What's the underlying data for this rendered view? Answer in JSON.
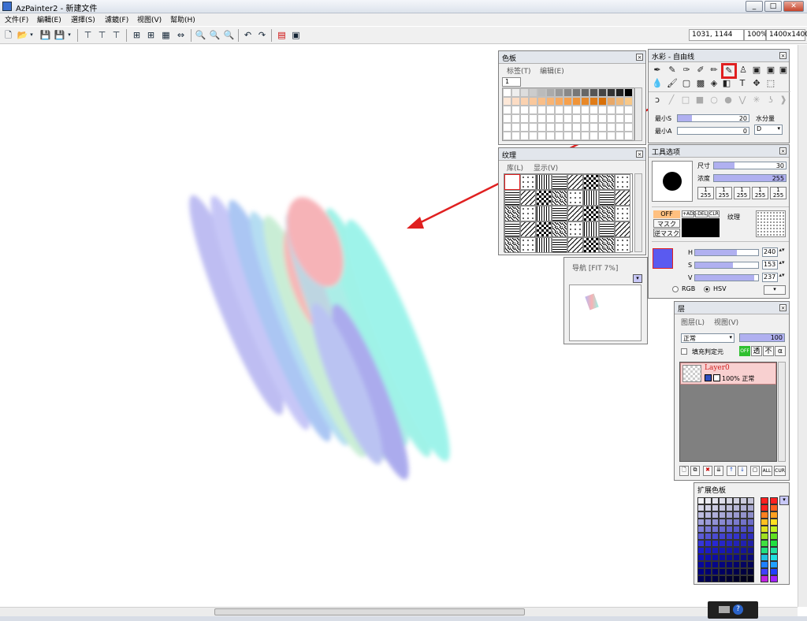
{
  "window": {
    "title": "AzPainter2 - 新建文件",
    "min": "_",
    "max": "□",
    "close": "✕"
  },
  "menu": [
    "文件(F)",
    "編輯(E)",
    "選擇(S)",
    "濾鏡(F)",
    "视图(V)",
    "幫助(H)"
  ],
  "status": {
    "coords": "1031, 1144",
    "zoom": "100%",
    "size": "1400x1400"
  },
  "palette_panel": {
    "title": "色板",
    "menu_tab": "标签(T)",
    "menu_edit": "编辑(E)",
    "tab": "1"
  },
  "texture_panel": {
    "title": "纹理",
    "menu_lib": "库(L)",
    "menu_show": "显示(V)"
  },
  "nav_panel": {
    "title": "导航 [FIT 7%]"
  },
  "brush_panel": {
    "title": "水彩 - 自由线",
    "min_s_label": "最小S",
    "min_s_val": "20",
    "min_a_label": "最小A",
    "min_a_val": "0",
    "water_label": "水分量",
    "water_val": "D"
  },
  "tool_options": {
    "title": "工具选项",
    "size_label": "尺寸",
    "size_val": "30",
    "density_label": "浓度",
    "density_val": "255",
    "presets": [
      "1 255",
      "1 255",
      "1 255",
      "1 255",
      "1 255"
    ],
    "off_label": "OFF",
    "mask_label": "マスク",
    "rev_mask_label": "逆マスク",
    "add_label": "+ADD",
    "del_label": "-DEL",
    "clr_label": "CLR",
    "texture_label": "纹理",
    "h_label": "H",
    "h_val": "240",
    "s_label": "S",
    "s_val": "153",
    "v_label": "V",
    "v_val": "237",
    "rgb_label": "RGB",
    "hsv_label": "HSV",
    "color": "#5a5af0"
  },
  "layer_panel": {
    "title": "层",
    "menu_layer": "图层(L)",
    "menu_view": "视图(V)",
    "blend": "正常",
    "opacity": "100",
    "fill_label": "填充判定元",
    "off_btn": "OFF",
    "trans_btn": "透",
    "notrans_btn": "不",
    "alpha_btn": "α",
    "layer_name": "Layer0",
    "layer_info": "100% 正常",
    "btn_all": "ALL",
    "btn_cur": "CUR"
  },
  "ext_palette": {
    "title": "扩展色板"
  }
}
